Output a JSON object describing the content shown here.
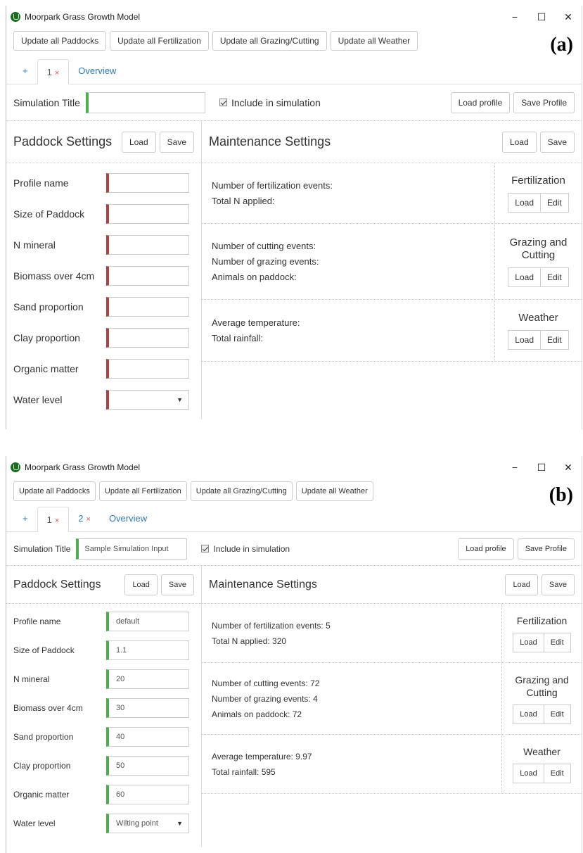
{
  "figures": [
    {
      "id": "a",
      "label": "(a)",
      "app_title": "Moorpark Grass Growth Model",
      "window_controls": {
        "minimize": "−",
        "maximize": "☐",
        "close": "✕"
      },
      "toolbar": [
        "Update all Paddocks",
        "Update all Fertilization",
        "Update all Grazing/Cutting",
        "Update all Weather"
      ],
      "tabs": {
        "add": "+",
        "items": [
          {
            "label": "1",
            "close": "×",
            "active": true
          }
        ],
        "overview": "Overview"
      },
      "sim": {
        "title_label": "Simulation Title",
        "title_value": "",
        "include_label": "Include in simulation",
        "include_checked": true,
        "load_profile": "Load profile",
        "save_profile": "Save Profile"
      },
      "paddock": {
        "title": "Paddock Settings",
        "load": "Load",
        "save": "Save",
        "fields": [
          {
            "label": "Profile name",
            "value": ""
          },
          {
            "label": "Size of Paddock",
            "value": ""
          },
          {
            "label": "N mineral",
            "value": ""
          },
          {
            "label": "Biomass over 4cm",
            "value": ""
          },
          {
            "label": "Sand proportion",
            "value": ""
          },
          {
            "label": "Clay proportion",
            "value": ""
          },
          {
            "label": "Organic matter",
            "value": ""
          },
          {
            "label": "Water level",
            "value": "",
            "select": true
          }
        ]
      },
      "maintenance": {
        "title": "Maintenance Settings",
        "load": "Load",
        "save": "Save",
        "sections": [
          {
            "title": "Fertilization",
            "lines": [
              "Number of fertilization events:",
              "Total N applied:"
            ],
            "load": "Load",
            "edit": "Edit"
          },
          {
            "title": "Grazing and Cutting",
            "lines": [
              "Number of cutting events:",
              "Number of grazing events:",
              "Animals on paddock:"
            ],
            "load": "Load",
            "edit": "Edit"
          },
          {
            "title": "Weather",
            "lines": [
              "Average temperature:",
              "Total rainfall:"
            ],
            "load": "Load",
            "edit": "Edit"
          }
        ]
      },
      "colors": {
        "required": "#a94442",
        "valid": "#4cae4c",
        "link": "#337ab7"
      }
    },
    {
      "id": "b",
      "label": "(b)",
      "app_title": "Moorpark Grass Growth Model",
      "window_controls": {
        "minimize": "−",
        "maximize": "☐",
        "close": "✕"
      },
      "toolbar": [
        "Update all Paddocks",
        "Update all Fertilization",
        "Update all Grazing/Cutting",
        "Update all Weather"
      ],
      "tabs": {
        "add": "+",
        "items": [
          {
            "label": "1",
            "close": "×",
            "active": true
          },
          {
            "label": "2",
            "close": "×",
            "active": false
          }
        ],
        "overview": "Overview"
      },
      "sim": {
        "title_label": "Simulation Title",
        "title_value": "Sample Simulation Input",
        "include_label": "Include in simulation",
        "include_checked": true,
        "load_profile": "Load profile",
        "save_profile": "Save Profile"
      },
      "paddock": {
        "title": "Paddock Settings",
        "load": "Load",
        "save": "Save",
        "fields": [
          {
            "label": "Profile name",
            "value": "default"
          },
          {
            "label": "Size of Paddock",
            "value": "1.1"
          },
          {
            "label": "N mineral",
            "value": "20"
          },
          {
            "label": "Biomass over 4cm",
            "value": "30"
          },
          {
            "label": "Sand proportion",
            "value": "40"
          },
          {
            "label": "Clay proportion",
            "value": "50"
          },
          {
            "label": "Organic matter",
            "value": "60"
          },
          {
            "label": "Water level",
            "value": "Wilting point",
            "select": true
          }
        ]
      },
      "maintenance": {
        "title": "Maintenance Settings",
        "load": "Load",
        "save": "Save",
        "sections": [
          {
            "title": "Fertilization",
            "lines": [
              "Number of fertilization events: 5",
              "Total N applied: 320"
            ],
            "load": "Load",
            "edit": "Edit"
          },
          {
            "title": "Grazing and Cutting",
            "lines": [
              "Number of cutting events: 72",
              "Number of grazing events: 4",
              "Animals on paddock: 72"
            ],
            "load": "Load",
            "edit": "Edit"
          },
          {
            "title": "Weather",
            "lines": [
              "Average temperature: 9.97",
              "Total rainfall: 595"
            ],
            "load": "Load",
            "edit": "Edit"
          }
        ]
      },
      "colors": {
        "required": "#a94442",
        "valid": "#4cae4c",
        "link": "#337ab7"
      }
    }
  ]
}
